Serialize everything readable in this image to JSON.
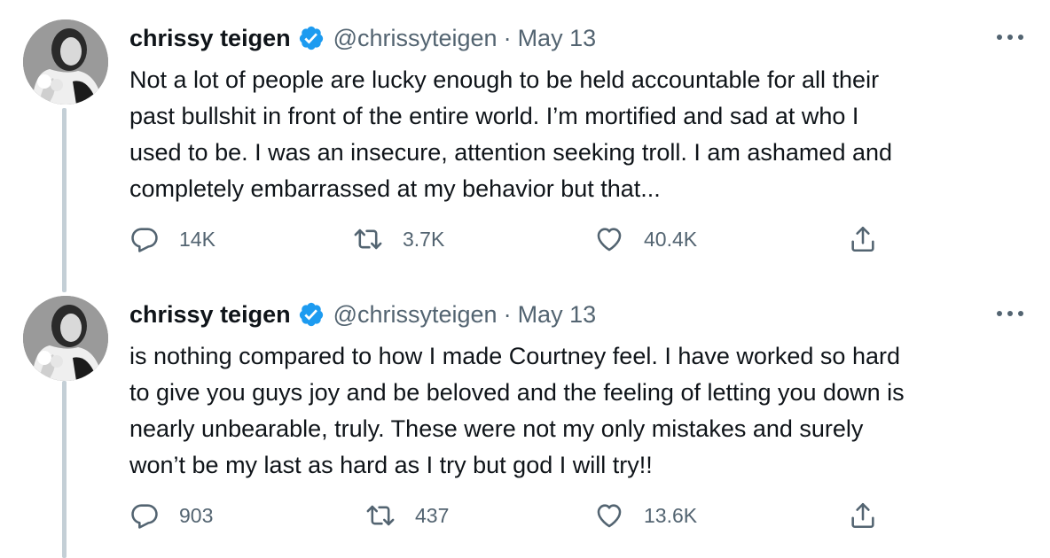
{
  "colors": {
    "verified": "#1d9bf0",
    "secondary_text": "#536471",
    "thread_line": "#c4cfd6"
  },
  "tweets": [
    {
      "author": "chrissy teigen",
      "handle": "@chrissyteigen",
      "separator": "·",
      "date": "May 13",
      "text": "Not a lot of people are lucky enough to be held accountable for all their\npast bullshit in front of the entire world. I’m mortified and sad at who I\nused to be. I was an insecure, attention seeking troll. I am ashamed and\ncompletely embarrassed at my behavior but that...",
      "replies": "14K",
      "retweets": "3.7K",
      "likes": "40.4K",
      "icons": {
        "reply": "reply-icon",
        "retweet": "retweet-icon",
        "like": "heart-icon",
        "share": "share-icon",
        "verified": "verified-badge-icon",
        "more": "more-icon"
      }
    },
    {
      "author": "chrissy teigen",
      "handle": "@chrissyteigen",
      "separator": "·",
      "date": "May 13",
      "text": "is nothing compared to how I made Courtney feel. I have worked so hard\nto give you guys joy and be beloved and the feeling of letting you down is\nnearly unbearable, truly. These were not my only mistakes and surely\nwon’t be my last as hard as I try but god I will try!!",
      "replies": "903",
      "retweets": "437",
      "likes": "13.6K",
      "icons": {
        "reply": "reply-icon",
        "retweet": "retweet-icon",
        "like": "heart-icon",
        "share": "share-icon",
        "verified": "verified-badge-icon",
        "more": "more-icon"
      }
    }
  ]
}
